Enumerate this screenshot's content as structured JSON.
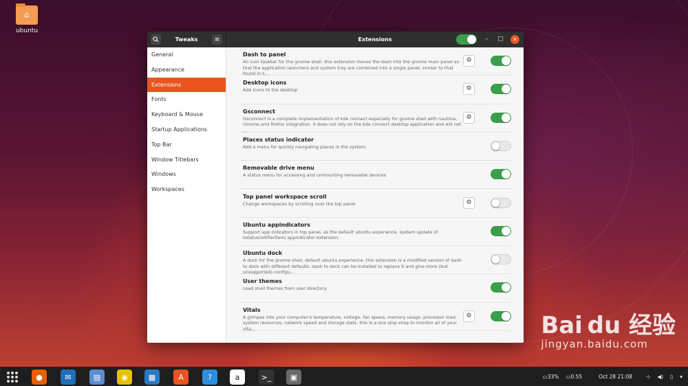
{
  "desktop": {
    "folder_label": "ubuntu"
  },
  "window": {
    "sidebar_title": "Tweaks",
    "main_title": "Extensions",
    "global_toggle_on": true,
    "minimize_glyph": "–",
    "maximize_glyph": "□",
    "close_glyph": "✕"
  },
  "sidebar": {
    "items": [
      {
        "label": "General",
        "active": false
      },
      {
        "label": "Appearance",
        "active": false
      },
      {
        "label": "Extensions",
        "active": true
      },
      {
        "label": "Fonts",
        "active": false
      },
      {
        "label": "Keyboard & Mouse",
        "active": false
      },
      {
        "label": "Startup Applications",
        "active": false
      },
      {
        "label": "Top Bar",
        "active": false
      },
      {
        "label": "Window Titlebars",
        "active": false
      },
      {
        "label": "Windows",
        "active": false
      },
      {
        "label": "Workspaces",
        "active": false
      }
    ]
  },
  "extensions": [
    {
      "name": "Dash to panel",
      "desc": "An icon taskbar for the gnome shell. this extension moves the dash into the gnome main panel so that the application launchers and system tray are combined into a single panel, similar to that found in k…",
      "settings": true,
      "enabled": true
    },
    {
      "name": "Desktop icons",
      "desc": "Add icons to the desktop",
      "settings": true,
      "enabled": true
    },
    {
      "name": "Gsconnect",
      "desc": "Gsconnect is a complete implementation of kde connect especially for gnome shell with nautilus, chrome and firefox integration. it does not rely on the kde connect desktop application and will not …",
      "settings": true,
      "enabled": true
    },
    {
      "name": "Places status indicator",
      "desc": "Add a menu for quickly navigating places in the system.",
      "settings": false,
      "enabled": false
    },
    {
      "name": "Removable drive menu",
      "desc": "A status menu for accessing and unmounting removable devices.",
      "settings": false,
      "enabled": true
    },
    {
      "name": "Top panel workspace scroll",
      "desc": "Change workspaces by scrolling over the top panel",
      "settings": true,
      "enabled": false
    },
    {
      "name": "Ubuntu appindicators",
      "desc": "Support app indicators in top panel, as the default ubuntu experience. system update of kstatusnotifieritem/ appindicator extension.",
      "settings": false,
      "enabled": true
    },
    {
      "name": "Ubuntu dock",
      "desc": "A dock for the gnome shell, default ubuntu experience. this extension is a modified version of dash to dock with different defaults. dash to dock can be installed to replace it and give more (but unsupported) configu…",
      "settings": false,
      "enabled": false
    },
    {
      "name": "User themes",
      "desc": "Load shell themes from user directory.",
      "settings": false,
      "enabled": true
    },
    {
      "name": "Vitals",
      "desc": "A glimpse into your computer's temperature, voltage, fan speed, memory usage, processor load, system resources, network speed and storage stats. this is a one stop shop to monitor all of your vita…",
      "settings": true,
      "enabled": true
    }
  ],
  "taskbar": {
    "apps": [
      {
        "name": "firefox-icon",
        "color": "#e66000",
        "glyph": "●",
        "running": true
      },
      {
        "name": "thunderbird-icon",
        "color": "#1f6fb6",
        "glyph": "✉",
        "running": false
      },
      {
        "name": "files-icon",
        "color": "#5b8dd6",
        "glyph": "▤",
        "running": false
      },
      {
        "name": "rhythmbox-icon",
        "color": "#e5c100",
        "glyph": "◉",
        "running": false
      },
      {
        "name": "writer-icon",
        "color": "#2a7ac4",
        "glyph": "▦",
        "running": false
      },
      {
        "name": "software-center-icon",
        "color": "#e95420",
        "glyph": "A",
        "running": false
      },
      {
        "name": "help-icon",
        "color": "#2d8ee0",
        "glyph": "?",
        "running": false
      },
      {
        "name": "amazon-icon",
        "color": "#ffffff",
        "glyph": "a",
        "running": false
      },
      {
        "name": "terminal-icon",
        "color": "#333333",
        "glyph": ">_",
        "running": true
      },
      {
        "name": "tweaks-icon",
        "color": "#6a6a6a",
        "glyph": "▣",
        "running": true
      }
    ],
    "battery": "33%",
    "load": "0.55",
    "datetime": "Oct 28  21:08"
  },
  "watermark": {
    "logo": "Bai du 经验",
    "url": "jingyan.baidu.com"
  },
  "colors": {
    "accent": "#e95420",
    "toggle_on": "#3a9e4b"
  }
}
